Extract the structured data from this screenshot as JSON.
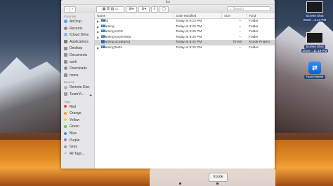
{
  "window": {
    "title": "lcs"
  },
  "toolbar": {
    "back": "‹",
    "forward": "›",
    "search_placeholder": "Search"
  },
  "sidebar": {
    "favorites_heading": "Favorites",
    "favorites": [
      {
        "label": "AirDrop",
        "icon": "airdrop-icon"
      },
      {
        "label": "Recents",
        "icon": "clock-icon"
      },
      {
        "label": "iCloud Drive",
        "icon": "cloud-icon"
      },
      {
        "label": "Applications",
        "icon": "applications-icon"
      },
      {
        "label": "Desktop",
        "icon": "desktop-icon"
      },
      {
        "label": "Documents",
        "icon": "documents-icon"
      },
      {
        "label": "work",
        "icon": "folder-icon"
      },
      {
        "label": "Downloads",
        "icon": "downloads-icon"
      },
      {
        "label": "home",
        "icon": "home-icon"
      }
    ],
    "devices_heading": "Devices",
    "devices": [
      {
        "label": "Remote Disc",
        "icon": "disc-icon"
      },
      {
        "label": "TeamVi...",
        "icon": "drive-icon",
        "eject": "⏏"
      }
    ],
    "tags_heading": "Tags",
    "tags": [
      {
        "label": "Red",
        "color": "#f0453a"
      },
      {
        "label": "Orange",
        "color": "#f79a2f"
      },
      {
        "label": "Yellow",
        "color": "#f4cf2c"
      },
      {
        "label": "Green",
        "color": "#5cc64a"
      },
      {
        "label": "Blue",
        "color": "#3f8cf2"
      },
      {
        "label": "Purple",
        "color": "#b36ad8"
      },
      {
        "label": "Gray",
        "color": "#9b9b9b"
      },
      {
        "label": "All Tags...",
        "color": "#cfcfcf"
      }
    ]
  },
  "columns": {
    "name": "Name",
    "date": "Date Modified",
    "size": "Size",
    "kind": "Kind"
  },
  "files": [
    {
      "name": "build",
      "date": "Today at 9:23 PM",
      "size": "--",
      "kind": "Folder",
      "type": "folder",
      "selected": false
    },
    {
      "name": "Learning",
      "date": "Today at 9:20 PM",
      "size": "--",
      "kind": "Folder",
      "type": "folder",
      "selected": false
    },
    {
      "name": "Learning-tvOS",
      "date": "Today at 9:20 PM",
      "size": "--",
      "kind": "Folder",
      "type": "folder",
      "selected": false
    },
    {
      "name": "Learning-tvOSTests",
      "date": "Today at 9:20 PM",
      "size": "--",
      "kind": "Folder",
      "type": "folder",
      "selected": false
    },
    {
      "name": "Learning.xcodeproj",
      "date": "Today at 8:44 PM",
      "size": "70 KB",
      "kind": "Xcode Project",
      "type": "project",
      "selected": true
    },
    {
      "name": "LearningTests",
      "date": "Today at 9:20 PM",
      "size": "--",
      "kind": "Folder",
      "type": "folder",
      "selected": false
    }
  ],
  "desktop_icons": [
    {
      "label1": "Screen Shot",
      "label2": "2018-...3.14 PM"
    },
    {
      "label1": "Screen Shot",
      "label2": "2018-...11.18 PM"
    },
    {
      "label1": "TeamViewer",
      "label2": ""
    }
  ],
  "dock": {
    "tooltip": "Xcode"
  }
}
